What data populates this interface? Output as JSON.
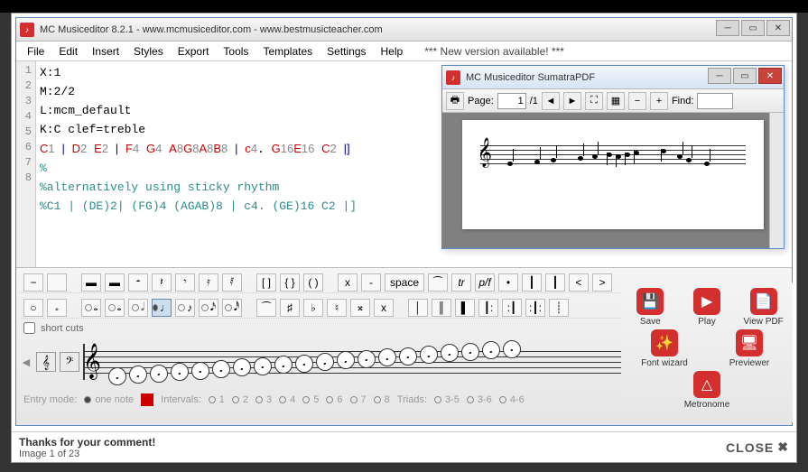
{
  "app": {
    "title": "MC Musiceditor 8.2.1 - www.mcmusiceditor.com - www.bestmusicteacher.com",
    "menu": [
      "File",
      "Edit",
      "Insert",
      "Styles",
      "Export",
      "Tools",
      "Templates",
      "Settings",
      "Help"
    ],
    "new_version": "*** New version available! ***"
  },
  "code_lines": [
    {
      "n": "1",
      "t": "X:1",
      "cls": "c-key"
    },
    {
      "n": "2",
      "t": "M:2/2",
      "cls": "c-key"
    },
    {
      "n": "3",
      "t": "L:mcm_default",
      "cls": "c-key"
    },
    {
      "n": "4",
      "t": "K:C clef=treble",
      "cls": "c-key"
    }
  ],
  "code5": {
    "parts": [
      "C",
      "1",
      " | ",
      "D",
      "2",
      " ",
      "E",
      "2",
      " | ",
      "F",
      "4",
      " ",
      "G",
      "4",
      " ",
      "A",
      "8",
      "G",
      "8",
      "A",
      "8",
      "B",
      "8",
      " | ",
      "c",
      "4",
      ". ",
      "G",
      "16",
      "E",
      "16",
      " ",
      "C",
      "2",
      " |]"
    ]
  },
  "code6": "%",
  "code7": "%alternatively using sticky rhythm",
  "code8": "%C1 | (DE)2| (FG)4 (AGAB)8 | c4. (GE)16 C2 |]",
  "pdf": {
    "title": "MC Musiceditor SumatraPDF",
    "page_label": "Page:",
    "page_val": "1",
    "page_total": "/1",
    "find_label": "Find:"
  },
  "toolbar": {
    "space": "space",
    "tr": "tr",
    "short_cuts": "short cuts",
    "minus": "−",
    "x": "x"
  },
  "entry": {
    "label": "Entry mode:",
    "one_note": "one note",
    "intervals": "Intervals:",
    "iv": [
      "1",
      "2",
      "3",
      "4",
      "5",
      "6",
      "7",
      "8"
    ],
    "triads": "Triads:",
    "tv": [
      "3-5",
      "3-6",
      "4-6"
    ]
  },
  "side": {
    "save": "Save",
    "play": "Play",
    "viewpdf": "View PDF",
    "fontwiz": "Font wizard",
    "preview": "Previewer",
    "metro": "Metronome"
  },
  "footer": {
    "thanks": "Thanks for your comment!",
    "img": "Image 1 of 23",
    "close": "CLOSE"
  }
}
